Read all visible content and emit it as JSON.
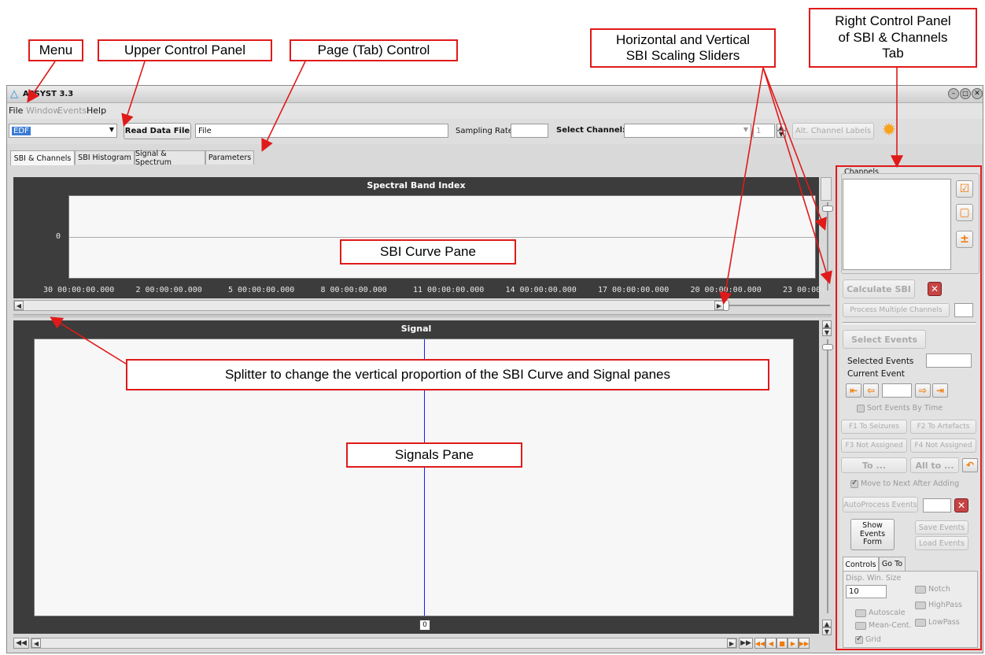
{
  "callouts": {
    "menu": "Menu",
    "upper_panel": "Upper Control Panel",
    "tab_control": "Page (Tab) Control",
    "sliders_line1": "Horizontal and Vertical",
    "sliders_line2": "SBI Scaling Sliders",
    "right_line1": "Right Control Panel",
    "right_line2": "of SBI & Channels",
    "right_line3": "Tab",
    "sbi_pane": "SBI Curve Pane",
    "splitter": "Splitter to change the vertical proportion of the SBI Curve and Signal panes",
    "signals_pane": "Signals Pane"
  },
  "window": {
    "title": "ASSYST 3.3",
    "menu": [
      "File",
      "Window",
      "Events",
      "Help"
    ]
  },
  "toolbar": {
    "format_value": "EDF",
    "read_button": "Read Data File",
    "file_value": "File",
    "sampling_label": "Sampling Rate",
    "select_channel_label": "Select Channel:",
    "channel_index": "1",
    "alt_labels_button": "Alt. Channel Labels",
    "settings_icon": "gear-icon"
  },
  "tabs": [
    "SBI & Channels",
    "SBI Histogram",
    "Signal & Spectrum",
    "Parameters"
  ],
  "sbi_pane": {
    "title": "Spectral Band Index",
    "y_tick": "0",
    "x_ticks": [
      "30 00:00:00.000",
      "2 00:00:00.000",
      "5 00:00:00.000",
      "8 00:00:00.000",
      "11 00:00:00.000",
      "14 00:00:00.000",
      "17 00:00:00.000",
      "20 00:00:00.000",
      "23 00:00:"
    ]
  },
  "signal_pane": {
    "title": "Signal",
    "marker_value": "0"
  },
  "right_panel": {
    "channels_label": "Channels",
    "calculate_sbi": "Calculate SBI",
    "process_multiple": "Process Multiple Channels",
    "select_events": "Select Events",
    "selected_events_label": "Selected Events",
    "current_event_label": "Current Event",
    "sort_events": "Sort Events By Time",
    "f1": "F1 To Seizures",
    "f2": "F2 To Artefacts",
    "f3": "F3 Not Assigned",
    "f4": "F4 Not Assigned",
    "to": "To ...",
    "all_to": "All to ...",
    "move_next": "Move to Next After Adding",
    "autoprocess": "AutoProcess Events",
    "show_events_line1": "Show",
    "show_events_line2": "Events",
    "show_events_line3": "Form",
    "save_events": "Save Events",
    "load_events": "Load Events",
    "tab_controls": "Controls",
    "tab_goto": "Go To",
    "disp_win_label": "Disp. Win. Size",
    "disp_win_value": "10",
    "notch": "Notch",
    "highpass": "HighPass",
    "lowpass": "LowPass",
    "autoscale": "Autoscale",
    "mean_cent": "Mean-Cent.",
    "grid": "Grid"
  },
  "colors": {
    "callout_border": "#e01a1a",
    "accent_orange": "#f07a0a",
    "signal_line": "#1a1aff"
  }
}
